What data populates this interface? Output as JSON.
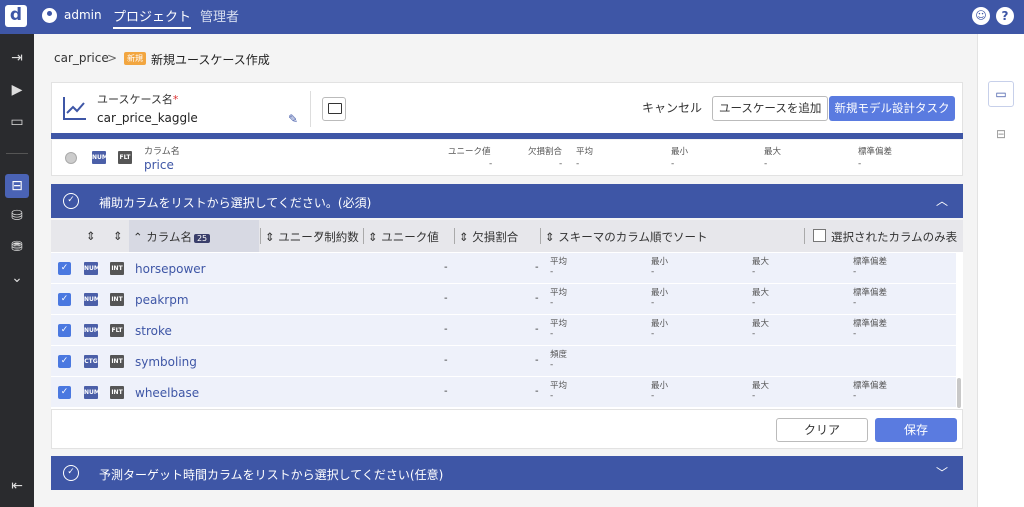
{
  "topbar": {
    "logo": "d",
    "user": "admin",
    "nav_project": "プロジェクト",
    "nav_admin": "管理者",
    "help": "?"
  },
  "breadcrumb": {
    "project": "car_price",
    "sep": ">",
    "badge": "新規",
    "title": "新規ユースケース作成"
  },
  "usecase": {
    "label": "ユースケース名",
    "required": "*",
    "value": "car_price_kaggle"
  },
  "actions": {
    "cancel": "キャンセル",
    "add": "ユースケースを追加",
    "new_task": "新規モデル設計タスク"
  },
  "target": {
    "badge1": "NUM",
    "badge2": "FLT",
    "col_label": "カラム名",
    "col_value": "price",
    "stat_labels": [
      "ユニーク値",
      "欠損割合",
      "平均",
      "最小",
      "最大",
      "標準偏差"
    ],
    "stat_values": [
      "-",
      "-",
      "-",
      "-",
      "-",
      "-"
    ]
  },
  "section1": {
    "title": "補助カラムをリストから選択してください。(必須)",
    "check": "✓",
    "chevron": "︿"
  },
  "columns": {
    "sort": "⇕",
    "name": "カラム名",
    "count": "25",
    "unique_limit": "ユニーク制約数",
    "unique": "ユニーク値",
    "missing": "欠損割合",
    "schema_sort": "スキーマのカラム順でソート",
    "only_selected": "選択されたカラムのみ表"
  },
  "rows": [
    {
      "badge1": "NUM",
      "badge2": "INT",
      "name": "horsepower",
      "d1": "-",
      "d2": "-",
      "labels": [
        "平均",
        "最小",
        "最大",
        "標準偏差"
      ],
      "values": [
        "-",
        "-",
        "-",
        "-"
      ]
    },
    {
      "badge1": "NUM",
      "badge2": "INT",
      "name": "peakrpm",
      "d1": "-",
      "d2": "-",
      "labels": [
        "平均",
        "最小",
        "最大",
        "標準偏差"
      ],
      "values": [
        "-",
        "-",
        "-",
        "-"
      ]
    },
    {
      "badge1": "NUM",
      "badge2": "FLT",
      "name": "stroke",
      "d1": "-",
      "d2": "-",
      "labels": [
        "平均",
        "最小",
        "最大",
        "標準偏差"
      ],
      "values": [
        "-",
        "-",
        "-",
        "-"
      ]
    },
    {
      "badge1": "CTG",
      "badge2": "INT",
      "name": "symboling",
      "d1": "-",
      "d2": "-",
      "labels": [
        "頻度"
      ],
      "values": [
        "-"
      ]
    },
    {
      "badge1": "NUM",
      "badge2": "INT",
      "name": "wheelbase",
      "d1": "-",
      "d2": "-",
      "labels": [
        "平均",
        "最小",
        "最大",
        "標準偏差"
      ],
      "values": [
        "-",
        "-",
        "-",
        "-"
      ]
    }
  ],
  "footer": {
    "clear": "クリア",
    "save": "保存"
  },
  "section2": {
    "title": "予測ターゲット時間カラムをリストから選択してください(任意)",
    "check": "✓",
    "chevron": "﹀"
  }
}
